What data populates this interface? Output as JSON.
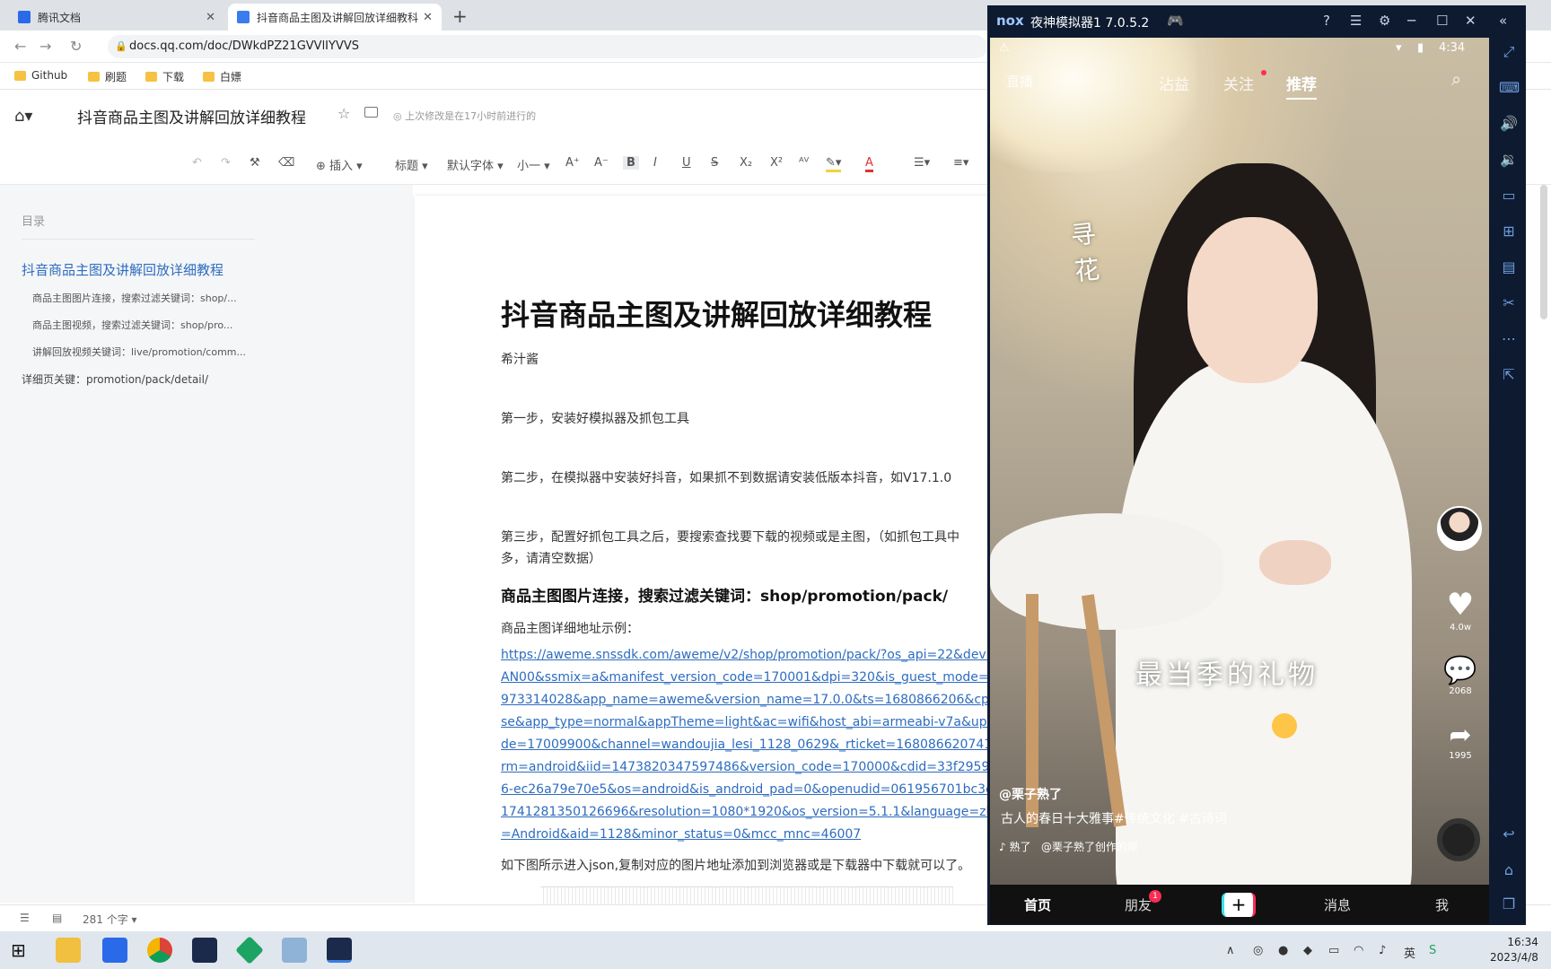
{
  "browser": {
    "tabs": [
      {
        "title": "腾讯文档",
        "icon_color": "#2a6ae8"
      },
      {
        "title": "抖音商品主图及讲解回放详细教科",
        "icon_color": "#3a7cf0"
      }
    ],
    "url": "docs.qq.com/doc/DWkdPZ21GVVlIYVVS",
    "bookmarks": [
      "Github",
      "刷题",
      "下载",
      "白嫖"
    ]
  },
  "doc_header": {
    "title": "抖音商品主图及讲解回放详细教程",
    "saved_status": "上次修改是在17小时前进行的"
  },
  "toolbar": {
    "insert": "插入",
    "style": "标题",
    "font": "默认字体",
    "size": "小一",
    "bold": "B",
    "italic": "I",
    "underline": "U",
    "strike": "S",
    "sub": "X₂",
    "sup": "X²",
    "font_color_label": "A"
  },
  "sidebar": {
    "heading": "目录",
    "items": [
      {
        "label": "抖音商品主图及讲解回放详细教程"
      },
      {
        "label": "商品主图图片连接，搜索过滤关键词：shop/..."
      },
      {
        "label": "商品主图视频，搜索过滤关键词：shop/pro..."
      },
      {
        "label": "讲解回放视频关键词：live/promotion/comm..."
      },
      {
        "label": "详细页关键：promotion/pack/detail/"
      }
    ]
  },
  "document": {
    "title": "抖音商品主图及讲解回放详细教程",
    "author": "希汁酱",
    "step1": "第一步，安装好模拟器及抓包工具",
    "step2": "第二步，在模拟器中安装好抖音，如果抓不到数据请安装低版本抖音，如V17.1.0",
    "step3_line1": "第三步，配置好抓包工具之后，要搜索查找要下载的视频或是主图，（如抓包工具中",
    "step3_line2": "多，请清空数据）",
    "section_heading": "商品主图图片连接，搜索过滤关键词：shop/promotion/pack/",
    "example_label": "商品主图详细地址示例：",
    "url_lines": [
      "https://aweme.snssdk.com/aweme/v2/shop/promotion/pack/?os_api=22&device_",
      "AN00&ssmix=a&manifest_version_code=170001&dpi=320&is_guest_mode=0&uu",
      "973314028&app_name=aweme&version_name=17.0.0&ts=1680866206&cpu_sup",
      "se&app_type=normal&appTheme=light&ac=wifi&host_abi=armeabi-v7a&update_v",
      "de=17009900&channel=wandoujia_lesi_1128_0629&_rticket=1680866207415&de",
      "rm=android&iid=1473820347597486&version_code=170000&cdid=33f29595-898b",
      "6-ec26a79e70e5&os=android&is_android_pad=0&openudid=061956701bc3c2fd&",
      "1741281350126696&resolution=1080*1920&os_version=5.1.1&language=zh&devi",
      "=Android&aid=1128&minor_status=0&mcc_mnc=46007"
    ],
    "footer_text": "如下图所示进入json,复制对应的图片地址添加到浏览器或是下载器中下载就可以了。",
    "word_count": "281 个字"
  },
  "emulator": {
    "logo": "nox",
    "title": "夜神模拟器1 7.0.5.2",
    "time": "4:34",
    "top_nav": [
      "直播",
      "沾益",
      "关注",
      "推荐"
    ],
    "overlay_vertical": "寻花",
    "caption": "最当季的礼物",
    "likes": "4.0w",
    "comments": "2068",
    "shares": "1995",
    "author": "@栗子熟了",
    "description": "古人的春日十大雅事#传统文化 #古诗词",
    "music_prefix": "熟了",
    "music": "@栗子熟了创作的原",
    "bottom_nav": {
      "home": "首页",
      "friends": "朋友",
      "friends_badge": "1",
      "messages": "消息",
      "me": "我",
      "plus": "+"
    }
  },
  "taskbar": {
    "time": "16:34",
    "date": "2023/4/8"
  }
}
